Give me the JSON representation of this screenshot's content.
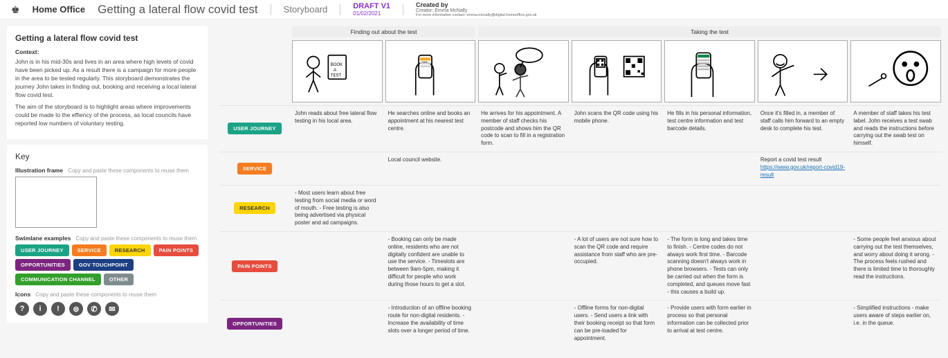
{
  "header": {
    "org": "Home Office",
    "title": "Getting a lateral flow covid test",
    "type": "Storyboard",
    "draft": "DRAFT V1",
    "date": "01/02/2021",
    "created_label": "Created by",
    "creator": "Creator: Emma McNally",
    "contact": "For more information contact: emma.mcnally@digital.homeoffice.gov.uk"
  },
  "sidebar": {
    "panel1": {
      "title": "Getting a lateral flow covid test",
      "context_label": "Context:",
      "context1": "John is in his mid-30s and lives in an area where high levels of covid have been picked up. As a result there is a campaign for more people in the area to be tested regularly. This storyboard demonstrates the journey John takes in finding out, booking and receiving a local lateral flow covid test.",
      "context2": "The aim of the storyboard is to highlight areas where improvements could be made to the effiency of the process, as local councils have reported low numbers of voluntary testing."
    },
    "panel2": {
      "title": "Key",
      "ill_label": "Illustration frame",
      "ill_hint": "Copy and paste these components to reuse them",
      "swim_label": "Swimlane examples",
      "swim_hint": "Copy and paste these components to reuse them",
      "tags": [
        "USER JOURNEY",
        "SERVICE",
        "RESEARCH",
        "PAIN POINTS",
        "OPPORTUNITIES",
        "GOV TOUCHPOINT",
        "COMMUNICATION CHANNEL",
        "OTHER"
      ],
      "icons_label": "Icons",
      "icons_hint": "Copy and paste these components to reuse them",
      "icons": [
        "?",
        "i",
        "!",
        "⊜",
        "✆",
        "✉"
      ]
    }
  },
  "board": {
    "groups": [
      "Finding out about the test",
      "Taking the test"
    ],
    "lanes": {
      "user_journey": {
        "label": "USER JOURNEY",
        "cells": [
          "John reads about free lateral flow testing in his local area.",
          "He searches online and books an appointment at his nearest test centre.",
          "He arrives for his appointment. A member of staff checks his postcode and shows him the QR code to scan to fill in a registration form.",
          "John scans the QR code using his mobile phone.",
          "He fills in his personal information, test centre information and test barcode details.",
          "Once it's filled in, a member of staff calls him forward to an empty desk to complete his test.",
          "A member of staff takes his test label. John receives a test swab and reads the instructions before carrying out the swab test on himself."
        ]
      },
      "service": {
        "label": "SERVICE",
        "cells": [
          "",
          "Local council website.",
          "",
          "",
          "",
          "Report a covid test result\nhttps://www.gov.uk/report-covid19-result",
          ""
        ]
      },
      "research": {
        "label": "RESEARCH",
        "cells": [
          "- Most users learn about free testing from social media or word of mouth.\n- Free testing is also being advertised via physical poster and ad campaigns.",
          "",
          "",
          "",
          "",
          "",
          ""
        ]
      },
      "pain_points": {
        "label": "PAIN POINTS",
        "cells": [
          "",
          "- Booking can only be made online, residents who are not digitally confident are unable to use the service.\n- Timeslots are between 9am-5pm, making it difficult for people who work during those hours to get a slot.",
          "",
          "- A lot of users are not sure how to scan the QR code and require assistance from staff who are pre-occupied.",
          "- The form is long and takes time to finish.\n- Centre codes do not always work first time.\n- Barcode scanning doesn't always work in phone browsers.\n- Tests can only be carried out when the form is completed, and queues move fast - this causes a build up.",
          "",
          "- Some people feel anxious about carrying out the test themselves, and worry about doing it wrong.\n- The process feels rushed and there is limited time to thoroughly read the instructions."
        ]
      },
      "opportunities": {
        "label": "OPPORTUNITIES",
        "cells": [
          "",
          "- Introduction of an offline booking route for non-digital residents.\n- Increase the availability of time slots over a longer period of time.",
          "",
          "- Offline forms for non-digital users.\n- Send users a link with their booking receipt so that form can be pre-loaded for appointment.",
          "- Provide users with form earlier in process so that personal information can be collected prior to arrival at test centre.",
          "",
          "- Simplified instructions - make users aware of steps earlier on, i.e. in the queue."
        ]
      }
    }
  }
}
